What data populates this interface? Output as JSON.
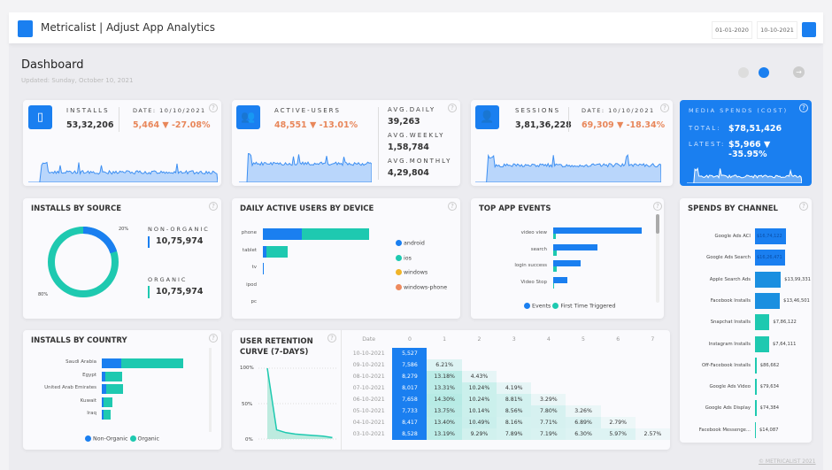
{
  "header": {
    "title": "Metricalist | Adjust App Analytics",
    "date_from": "01-01-2020",
    "date_to": "10-10-2021"
  },
  "page": {
    "title": "Dashboard",
    "updated": "Updated: Sunday, October 10, 2021",
    "footer": "© METRICALIST 2021"
  },
  "kpis": {
    "installs": {
      "label": "INSTALLS",
      "value": "53,32,206",
      "date_label": "DATE: 10/10/2021",
      "latest": "5,464 ▼ -27.08%"
    },
    "active_users": {
      "label": "ACTIVE-USERS",
      "latest": "48,551 ▼ -13.01%",
      "avg_daily_label": "AVG.DAILY",
      "avg_daily": "39,263",
      "avg_weekly_label": "AVG.WEEKLY",
      "avg_weekly": "1,58,784",
      "avg_monthly_label": "AVG.MONTHLY",
      "avg_monthly": "4,29,804"
    },
    "sessions": {
      "label": "SESSIONS",
      "value": "3,81,36,228",
      "date_label": "DATE: 10/10/2021",
      "latest": "69,309 ▼ -18.34%"
    },
    "media": {
      "label": "MEDIA SPENDS (COST)",
      "total_label": "TOTAL:",
      "total": "$78,51,426",
      "latest_label": "LATEST:",
      "latest": "$5,966 ▼ -35.95%"
    }
  },
  "colors": {
    "accent": "#1a7ff0",
    "teal": "#1ec9b0",
    "orange": "#e8875a",
    "yellow": "#f0b429",
    "coral": "#ee8a5e"
  },
  "source": {
    "title": "INSTALLS BY SOURCE",
    "non_organic_label": "NON-ORGANIC",
    "non_organic": "10,75,974",
    "organic_label": "ORGANIC",
    "organic": "10,75,974",
    "pct_non": "20%",
    "pct_org": "80%",
    "chart_data": {
      "type": "pie",
      "values": [
        20,
        80
      ]
    }
  },
  "device": {
    "title": "DAILY ACTIVE USERS BY DEVICE",
    "categories": [
      "phone",
      "tablet",
      "tv",
      "ipod",
      "pc"
    ],
    "legend": [
      "android",
      "ios",
      "windows",
      "windows-phone"
    ],
    "chart_data": {
      "type": "bar",
      "series": [
        {
          "name": "android",
          "values": [
            37,
            3,
            0.5,
            0,
            0
          ]
        },
        {
          "name": "ios",
          "values": [
            63,
            20,
            0,
            0,
            0
          ]
        }
      ]
    }
  },
  "events": {
    "title": "TOP APP EVENTS",
    "categories": [
      "video view",
      "search",
      "login success",
      "Video Stop"
    ],
    "legend": [
      "Events",
      "First Time Triggered"
    ],
    "chart_data": {
      "type": "bar",
      "series": [
        {
          "name": "Events",
          "values": [
            100,
            50,
            31,
            16
          ]
        },
        {
          "name": "First Time Triggered",
          "values": [
            3,
            4,
            4,
            1
          ]
        }
      ]
    }
  },
  "spends": {
    "title": "SPENDS BY CHANNEL",
    "items": [
      {
        "name": "Google Ads ACI",
        "label": "$16,74,122",
        "value": 1674122
      },
      {
        "name": "Google Ads Search",
        "label": "$16,26,471",
        "value": 1626471
      },
      {
        "name": "Apple Search Ads",
        "label": "$13,99,331",
        "value": 1399331
      },
      {
        "name": "Facebook Installs",
        "label": "$13,46,501",
        "value": 1346501
      },
      {
        "name": "Snapchat Installs",
        "label": "$7,86,122",
        "value": 786122
      },
      {
        "name": "Instagram Installs",
        "label": "$7,64,111",
        "value": 764111
      },
      {
        "name": "Off-Facebook Installs",
        "label": "$86,662",
        "value": 86662
      },
      {
        "name": "Google Ads Video",
        "label": "$79,634",
        "value": 79634
      },
      {
        "name": "Google Ads Display",
        "label": "$74,384",
        "value": 74384
      },
      {
        "name": "Facebook Messenge...",
        "label": "$14,087",
        "value": 14087
      }
    ]
  },
  "country": {
    "title": "INSTALLS BY COUNTRY",
    "categories": [
      "Saudi Arabia",
      "Egypt",
      "United Arab Emirates",
      "Kuwait",
      "Iraq"
    ],
    "legend": [
      "Non-Organic",
      "Organic"
    ],
    "chart_data": {
      "type": "bar",
      "series": [
        {
          "name": "Non-Organic",
          "values": [
            22,
            4,
            4.5,
            2,
            1.5
          ]
        },
        {
          "name": "Organic",
          "values": [
            70,
            19,
            19,
            10,
            8
          ]
        }
      ]
    }
  },
  "retention": {
    "title": "USER RETENTION CURVE (7-DAYS)",
    "yticks": [
      "100%",
      "50%",
      "0%"
    ],
    "chart_data": {
      "type": "area",
      "x": [
        0,
        1,
        2,
        3,
        4,
        5,
        6,
        7
      ],
      "y": [
        100,
        13,
        9,
        7,
        6,
        5,
        4,
        2
      ]
    },
    "headers": [
      "Date",
      "0",
      "1",
      "2",
      "3",
      "4",
      "5",
      "6",
      "7"
    ],
    "rows": [
      [
        "10-10-2021",
        "5,527"
      ],
      [
        "09-10-2021",
        "7,586",
        "6.21%"
      ],
      [
        "08-10-2021",
        "8,279",
        "13.18%",
        "4.43%"
      ],
      [
        "07-10-2021",
        "8,017",
        "13.31%",
        "10.24%",
        "4.19%"
      ],
      [
        "06-10-2021",
        "7,658",
        "14.30%",
        "10.24%",
        "8.81%",
        "3.29%"
      ],
      [
        "05-10-2021",
        "7,733",
        "13.75%",
        "10.14%",
        "8.56%",
        "7.80%",
        "3.26%"
      ],
      [
        "04-10-2021",
        "8,417",
        "13.40%",
        "10.49%",
        "8.16%",
        "7.71%",
        "6.89%",
        "2.79%"
      ],
      [
        "03-10-2021",
        "8,528",
        "13.19%",
        "9.29%",
        "7.89%",
        "7.19%",
        "6.30%",
        "5.97%",
        "2.57%"
      ]
    ]
  }
}
